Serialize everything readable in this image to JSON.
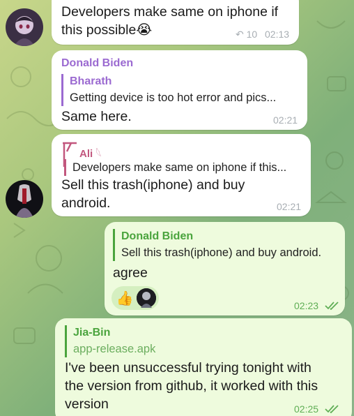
{
  "messages": [
    {
      "text_line1": "Developers make same on iphone if",
      "text_line2": "this possible",
      "emoji": "😭",
      "reply_count": "10",
      "time": "02:13"
    },
    {
      "sender": "Donald Biden",
      "reply_name": "Bharath",
      "reply_text": "Getting device is too hot error and pics...",
      "text": "Same here.",
      "time": "02:21"
    },
    {
      "sender": "Ali",
      "sender_suffix": "𓆩",
      "reply_text": "Developers make same on iphone if this...",
      "text_line1": "Sell this trash(iphone) and buy",
      "text_line2": "android.",
      "time": "02:21"
    },
    {
      "reply_name": "Donald Biden",
      "reply_text": "Sell this trash(iphone) and buy android.",
      "text": "agree",
      "reactions": [
        "thumbs-up",
        "avatar"
      ],
      "time": "02:23"
    },
    {
      "reply_name": "Jia-Bin",
      "reply_text": "app-release.apk",
      "text_line1": "I've been unsuccessful trying tonight with",
      "text_line2": "the version from github, it worked with this",
      "text_line3": "version",
      "time": "02:25"
    }
  ],
  "colors": {
    "incoming_bubble": "#ffffff",
    "outgoing_bubble": "#eefbdd",
    "sender_purple": "#9b6ad1",
    "reply_pink": "#c2577e",
    "outgoing_green": "#4aa43d",
    "time_gray": "#a8aeb3"
  }
}
